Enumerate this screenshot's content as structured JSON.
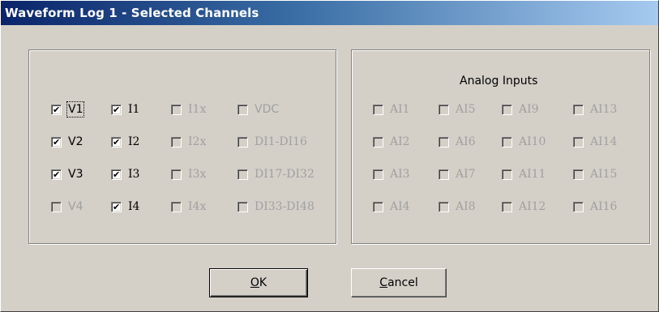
{
  "window": {
    "title": "Waveform Log 1 - Selected Channels"
  },
  "analog_group": {
    "label": "Analog Inputs"
  },
  "checkboxes": {
    "V1": {
      "label": "V1",
      "checked": true,
      "enabled": true
    },
    "V2": {
      "label": "V2",
      "checked": true,
      "enabled": true
    },
    "V3": {
      "label": "V3",
      "checked": true,
      "enabled": true
    },
    "V4": {
      "label": "V4",
      "checked": false,
      "enabled": false
    },
    "I1": {
      "label": "I1",
      "checked": true,
      "enabled": true
    },
    "I2": {
      "label": "I2",
      "checked": true,
      "enabled": true
    },
    "I3": {
      "label": "I3",
      "checked": true,
      "enabled": true
    },
    "I4": {
      "label": "I4",
      "checked": true,
      "enabled": true
    },
    "I1x": {
      "label": "I1x",
      "checked": false,
      "enabled": false
    },
    "I2x": {
      "label": "I2x",
      "checked": false,
      "enabled": false
    },
    "I3x": {
      "label": "I3x",
      "checked": false,
      "enabled": false
    },
    "I4x": {
      "label": "I4x",
      "checked": false,
      "enabled": false
    },
    "VDC": {
      "label": "VDC",
      "checked": false,
      "enabled": false
    },
    "DI1_DI16": {
      "label": "DI1-DI16",
      "checked": false,
      "enabled": false
    },
    "DI17_DI32": {
      "label": "DI17-DI32",
      "checked": false,
      "enabled": false
    },
    "DI33_DI48": {
      "label": "DI33-DI48",
      "checked": false,
      "enabled": false
    },
    "AI1": {
      "label": "AI1",
      "checked": false,
      "enabled": false
    },
    "AI2": {
      "label": "AI2",
      "checked": false,
      "enabled": false
    },
    "AI3": {
      "label": "AI3",
      "checked": false,
      "enabled": false
    },
    "AI4": {
      "label": "AI4",
      "checked": false,
      "enabled": false
    },
    "AI5": {
      "label": "AI5",
      "checked": false,
      "enabled": false
    },
    "AI6": {
      "label": "AI6",
      "checked": false,
      "enabled": false
    },
    "AI7": {
      "label": "AI7",
      "checked": false,
      "enabled": false
    },
    "AI8": {
      "label": "AI8",
      "checked": false,
      "enabled": false
    },
    "AI9": {
      "label": "AI9",
      "checked": false,
      "enabled": false
    },
    "AI10": {
      "label": "AI10",
      "checked": false,
      "enabled": false
    },
    "AI11": {
      "label": "AI11",
      "checked": false,
      "enabled": false
    },
    "AI12": {
      "label": "AI12",
      "checked": false,
      "enabled": false
    },
    "AI13": {
      "label": "AI13",
      "checked": false,
      "enabled": false
    },
    "AI14": {
      "label": "AI14",
      "checked": false,
      "enabled": false
    },
    "AI15": {
      "label": "AI15",
      "checked": false,
      "enabled": false
    },
    "AI16": {
      "label": "AI16",
      "checked": false,
      "enabled": false
    }
  },
  "buttons": {
    "ok": {
      "mnemonic": "O",
      "rest": "K"
    },
    "cancel": {
      "mnemonic": "C",
      "rest": "ancel"
    }
  }
}
